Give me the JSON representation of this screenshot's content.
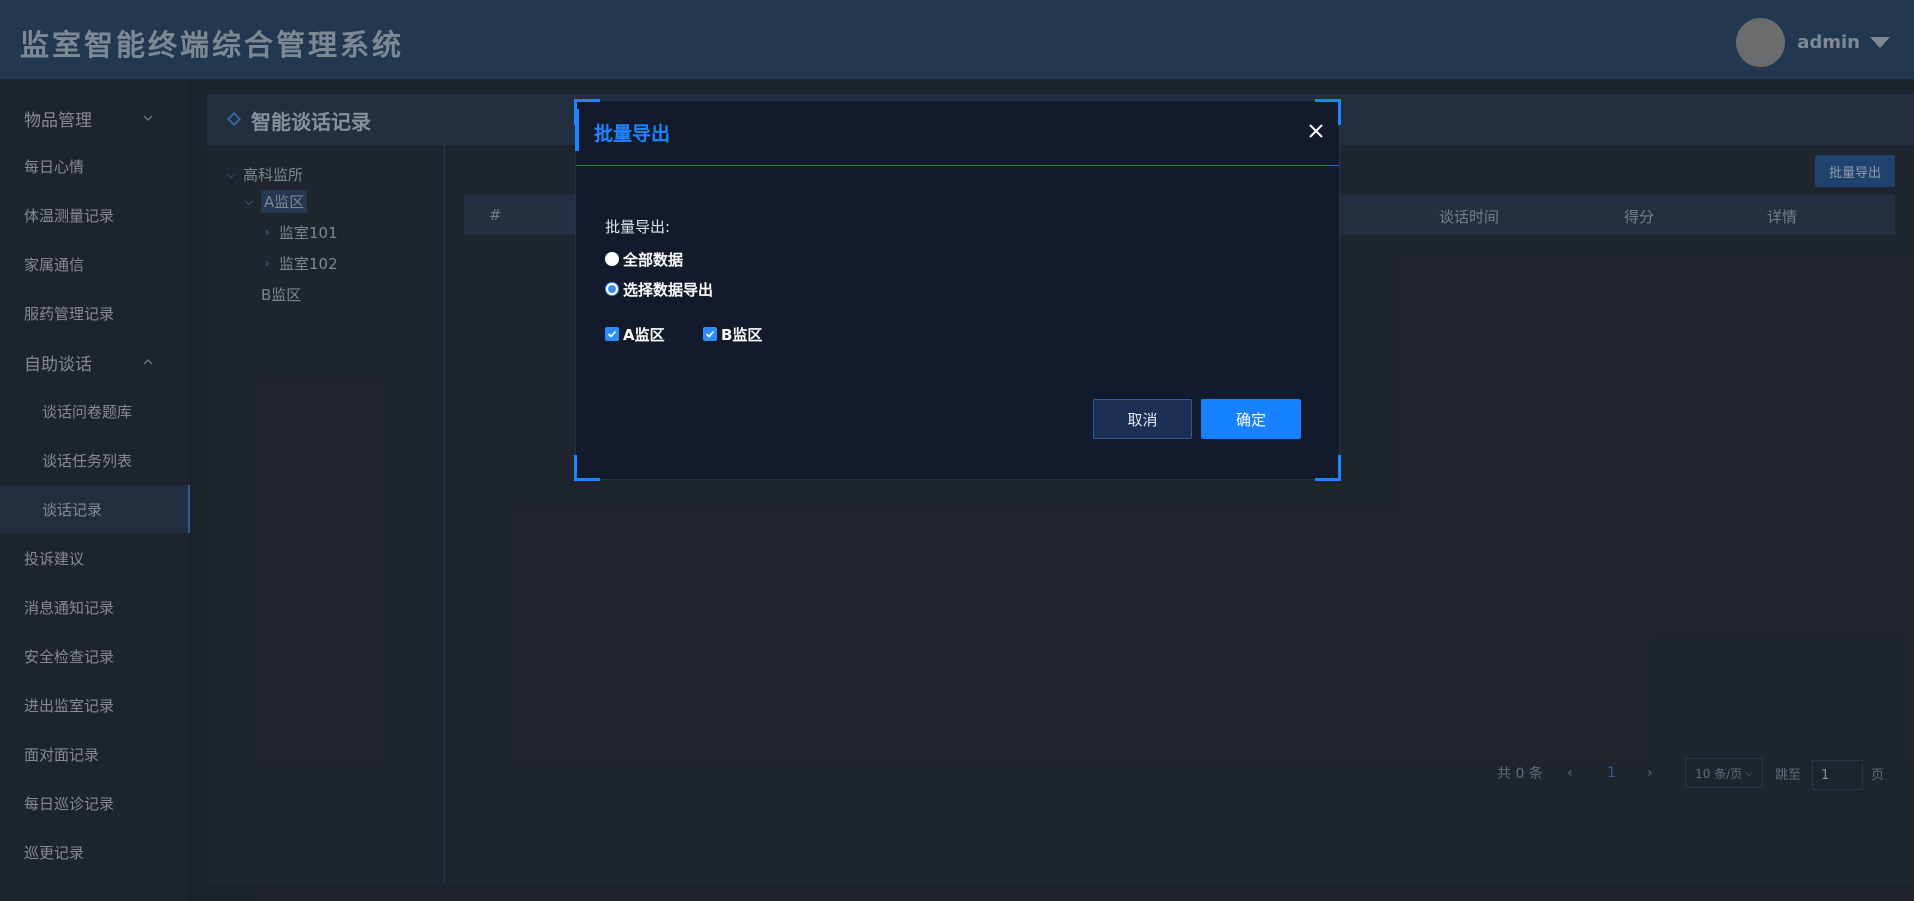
{
  "header": {
    "app_title": "监室智能终端综合管理系统",
    "username": "admin"
  },
  "sidebar": {
    "items": [
      {
        "label": "物品管理",
        "expandable": true,
        "expanded": false
      },
      {
        "label": "每日心情"
      },
      {
        "label": "体温测量记录"
      },
      {
        "label": "家属通信"
      },
      {
        "label": "服药管理记录"
      },
      {
        "label": "自助谈话",
        "expandable": true,
        "expanded": true
      },
      {
        "label": "谈话问卷题库",
        "sub": true
      },
      {
        "label": "谈话任务列表",
        "sub": true
      },
      {
        "label": "谈话记录",
        "sub": true,
        "active": true
      },
      {
        "label": "投诉建议"
      },
      {
        "label": "消息通知记录"
      },
      {
        "label": "安全检查记录"
      },
      {
        "label": "进出监室记录"
      },
      {
        "label": "面对面记录"
      },
      {
        "label": "每日巡诊记录"
      },
      {
        "label": "巡更记录"
      }
    ]
  },
  "panel": {
    "title": "智能谈话记录",
    "tree": [
      {
        "label": "高科监所",
        "expanded": true
      },
      {
        "label": "A监区",
        "expanded": true,
        "selected": true
      },
      {
        "label": "监室101"
      },
      {
        "label": "监室102"
      },
      {
        "label": "B监区"
      }
    ],
    "export_button": "批量导出",
    "table": {
      "columns": [
        "#",
        "谈话时间",
        "得分",
        "详情"
      ]
    },
    "pagination": {
      "total": "共 0 条",
      "current_page": "1",
      "page_size": "10 条/页",
      "goto_label": "跳至",
      "goto_value": "1",
      "page_suffix": "页"
    }
  },
  "dialog": {
    "title": "批量导出",
    "label": "批量导出:",
    "options": [
      {
        "label": "全部数据",
        "selected": false
      },
      {
        "label": "选择数据导出",
        "selected": true
      }
    ],
    "checkboxes": [
      {
        "label": "A监区",
        "checked": true
      },
      {
        "label": "B监区",
        "checked": true
      }
    ],
    "cancel": "取消",
    "confirm": "确定"
  },
  "colors": {
    "accent": "#1e84ff",
    "header_bg": "#2a4a6c",
    "dialog_bg": "#121a2c"
  }
}
